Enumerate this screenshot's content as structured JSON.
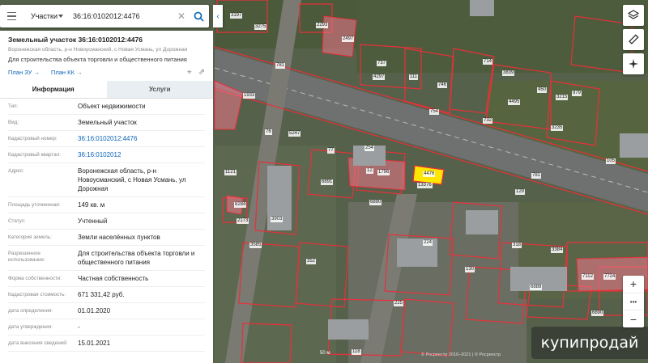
{
  "search": {
    "type_label": "Участки",
    "query": "36:16:0102012:4476"
  },
  "parcel": {
    "title": "Земельный участок 36:16:0102012:4476",
    "address_short": "Воронежская область, р-н Новоусманский, с Новая Усмань, ул Дорожная",
    "use": "Для строительства объекта торговли и общественного питания",
    "link_plan_zu": "План ЗУ →",
    "link_plan_kk": "План КК →"
  },
  "tabs": {
    "info": "Информация",
    "services": "Услуги"
  },
  "rows": [
    {
      "label": "Тип:",
      "value": "Объект недвижимости",
      "link": false
    },
    {
      "label": "Вид:",
      "value": "Земельный участок",
      "link": false
    },
    {
      "label": "Кадастровый номер:",
      "value": "36:16:0102012:4476",
      "link": true
    },
    {
      "label": "Кадастровый квартал:",
      "value": "36:16:0102012",
      "link": true
    },
    {
      "label": "Адрес:",
      "value": "Воронежская область, р-н Новоусманский, с Новая Усмань, ул Дорожная",
      "link": false
    },
    {
      "label": "Площадь уточненная:",
      "value": "149 кв. м",
      "link": false
    },
    {
      "label": "Статус:",
      "value": "Учтенный",
      "link": false
    },
    {
      "label": "Категория земель:",
      "value": "Земли населённых пунктов",
      "link": false
    },
    {
      "label": "Разрешенное использование:",
      "value": "Для строительства объекта торговли и общественного питания",
      "link": false
    },
    {
      "label": "Форма собственности:",
      "value": "Частная собственность",
      "link": false
    },
    {
      "label": "Кадастровая стоимость:",
      "value": "671 331,42 руб.",
      "link": false
    },
    {
      "label": "дата определения:",
      "value": "01.01.2020",
      "link": false
    },
    {
      "label": "дата утверждения:",
      "value": "-",
      "link": false
    },
    {
      "label": "дата внесения сведений:",
      "value": "15.01.2021",
      "link": false
    }
  ],
  "map": {
    "scale": "50 м",
    "copyright": "© Росреестр 2010–2021 | © Росреестр",
    "watermark": "купипродай",
    "labels": [
      "3197",
      "3275",
      "2293",
      "2497",
      "781",
      "737",
      "4297",
      "111",
      "746",
      "714",
      "3839",
      "4495",
      "450",
      "3215",
      "979",
      "3235",
      "1933",
      "754",
      "5247",
      "732",
      "76",
      "77",
      "254",
      "1796",
      "1121",
      "6891",
      "4476",
      "12",
      "13376",
      "781",
      "105",
      "129",
      "6890",
      "3903",
      "8284",
      "2173",
      "3585",
      "224",
      "318",
      "3384",
      "352",
      "130",
      "6888",
      "7112",
      "6890",
      "225",
      "118",
      "7724"
    ]
  },
  "colors": {
    "parcel_line": "#e8303a",
    "selected": "#ffe600",
    "link": "#0a63b8"
  }
}
